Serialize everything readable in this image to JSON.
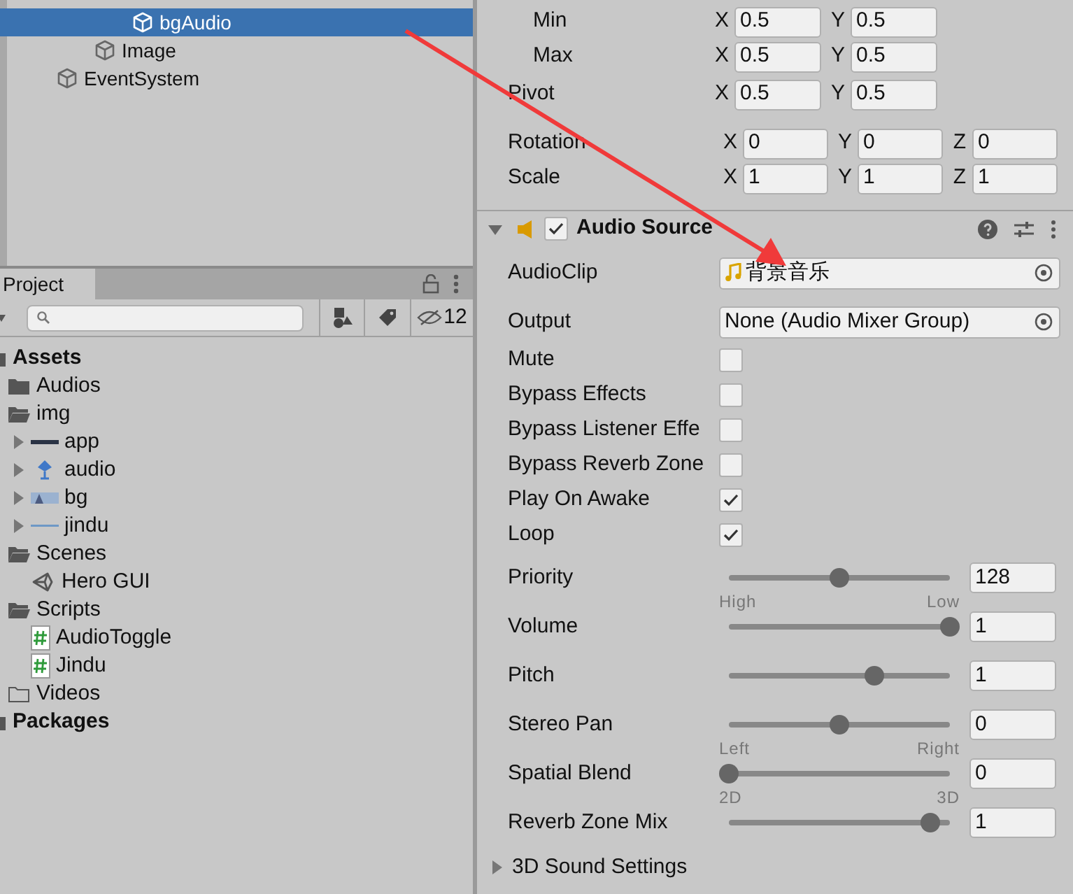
{
  "hierarchy": {
    "items": [
      {
        "children": [
          {
            "children": [
              {
                "label": "bgAudio",
                "selected": true
              }
            ]
          },
          {
            "label": "Image",
            "selected": false
          }
        ]
      },
      {
        "label": "EventSystem",
        "selected": false
      }
    ]
  },
  "project": {
    "tab": "Project",
    "hidden_count": "12",
    "tree": [
      {
        "label": "Assets",
        "kind": "root",
        "children": [
          {
            "label": "Audios",
            "kind": "folder"
          },
          {
            "label": "img",
            "kind": "folder-open",
            "children": [
              {
                "label": "app",
                "kind": "sprite-bar",
                "expanded": false
              },
              {
                "label": "audio",
                "kind": "sprite-icon",
                "expanded": false
              },
              {
                "label": "bg",
                "kind": "sprite-photo",
                "expanded": false
              },
              {
                "label": "jindu",
                "kind": "sprite-line",
                "expanded": false
              }
            ]
          },
          {
            "label": "Scenes",
            "kind": "folder-open",
            "children": [
              {
                "label": "Hero GUI",
                "kind": "scene"
              }
            ]
          },
          {
            "label": "Scripts",
            "kind": "folder-open",
            "children": [
              {
                "label": "AudioToggle",
                "kind": "script"
              },
              {
                "label": "Jindu",
                "kind": "script"
              }
            ]
          },
          {
            "label": "Videos",
            "kind": "folder-empty"
          }
        ]
      },
      {
        "label": "Packages",
        "kind": "root"
      }
    ]
  },
  "inspector": {
    "anchors": [
      {
        "label": "Min",
        "fields": [
          {
            "axis": "X",
            "value": "0.5"
          },
          {
            "axis": "Y",
            "value": "0.5"
          }
        ]
      },
      {
        "label": "Max",
        "fields": [
          {
            "axis": "X",
            "value": "0.5"
          },
          {
            "axis": "Y",
            "value": "0.5"
          }
        ]
      }
    ],
    "pivot": {
      "label": "Pivot",
      "fields": [
        {
          "axis": "X",
          "value": "0.5"
        },
        {
          "axis": "Y",
          "value": "0.5"
        }
      ]
    },
    "transform": [
      {
        "label": "Rotation",
        "fields": [
          {
            "axis": "X",
            "value": "0"
          },
          {
            "axis": "Y",
            "value": "0"
          },
          {
            "axis": "Z",
            "value": "0"
          }
        ]
      },
      {
        "label": "Scale",
        "fields": [
          {
            "axis": "X",
            "value": "1"
          },
          {
            "axis": "Y",
            "value": "1"
          },
          {
            "axis": "Z",
            "value": "1"
          }
        ]
      }
    ],
    "audio_source": {
      "title": "Audio Source",
      "enabled": true,
      "expanded": true,
      "properties": [
        {
          "kind": "clip",
          "label": "AudioClip",
          "value": "背景音乐"
        },
        {
          "kind": "object",
          "label": "Output",
          "value": "None (Audio Mixer Group)"
        },
        {
          "kind": "toggle",
          "label": "Mute",
          "checked": false
        },
        {
          "kind": "toggle",
          "label": "Bypass Effects",
          "checked": false
        },
        {
          "kind": "toggle",
          "label": "Bypass Listener Effe",
          "checked": false
        },
        {
          "kind": "toggle",
          "label": "Bypass Reverb Zone",
          "checked": false
        },
        {
          "kind": "toggle",
          "label": "Play On Awake",
          "checked": true
        },
        {
          "kind": "toggle",
          "label": "Loop",
          "checked": true
        },
        {
          "kind": "slider",
          "label": "Priority",
          "level": 0.5,
          "value": "128",
          "min_label": "High",
          "max_label": "Low"
        },
        {
          "kind": "slider",
          "label": "Volume",
          "level": 1,
          "value": "1"
        },
        {
          "kind": "slider",
          "label": "Pitch",
          "level": 0.66,
          "value": "1"
        },
        {
          "kind": "slider",
          "label": "Stereo Pan",
          "level": 0.5,
          "value": "0",
          "min_label": "Left",
          "max_label": "Right"
        },
        {
          "kind": "slider",
          "label": "Spatial Blend",
          "level": 0,
          "value": "0",
          "min_label": "2D",
          "max_label": "3D"
        },
        {
          "kind": "slider",
          "label": "Reverb Zone Mix",
          "level": 0.91,
          "value": "1"
        }
      ],
      "sub_section": {
        "label": "3D Sound Settings",
        "expanded": false
      }
    }
  }
}
